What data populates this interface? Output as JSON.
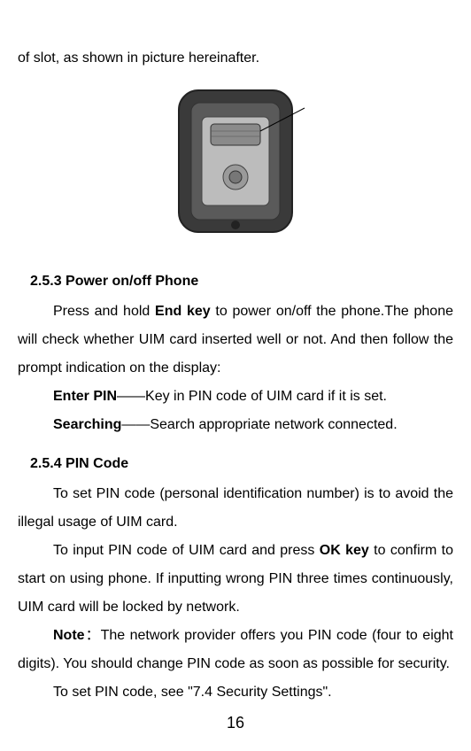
{
  "intro": "of slot, as shown in picture hereinafter.",
  "section253": {
    "heading": "2.5.3 Power on/off Phone",
    "para1_prefix": "Press and hold ",
    "para1_bold1": "End key",
    "para1_suffix": " to power on/off the phone.The phone will check whether UIM card inserted well or not. And then follow the prompt indication on the display:",
    "enterpin_label": "Enter PIN",
    "enterpin_text": "——Key in PIN code of UIM card if it is set.",
    "searching_label": "Searching",
    "searching_text": "——Search appropriate network connected."
  },
  "section254": {
    "heading": "2.5.4 PIN Code",
    "para1": "To set PIN code (personal identification number) is to avoid the illegal usage of UIM card.",
    "para2_prefix": "To input PIN code of UIM card and press ",
    "para2_bold": "OK key",
    "para2_suffix": " to confirm to start on using phone. If inputting wrong PIN three times continuously, UIM card will be locked by network.",
    "note_label": "Note",
    "note_text": "：The network provider offers you PIN code (four to eight digits). You should change PIN code as soon as possible for security.",
    "para4": "To set PIN code, see \"7.4 Security Settings\"."
  },
  "page_number": "16"
}
